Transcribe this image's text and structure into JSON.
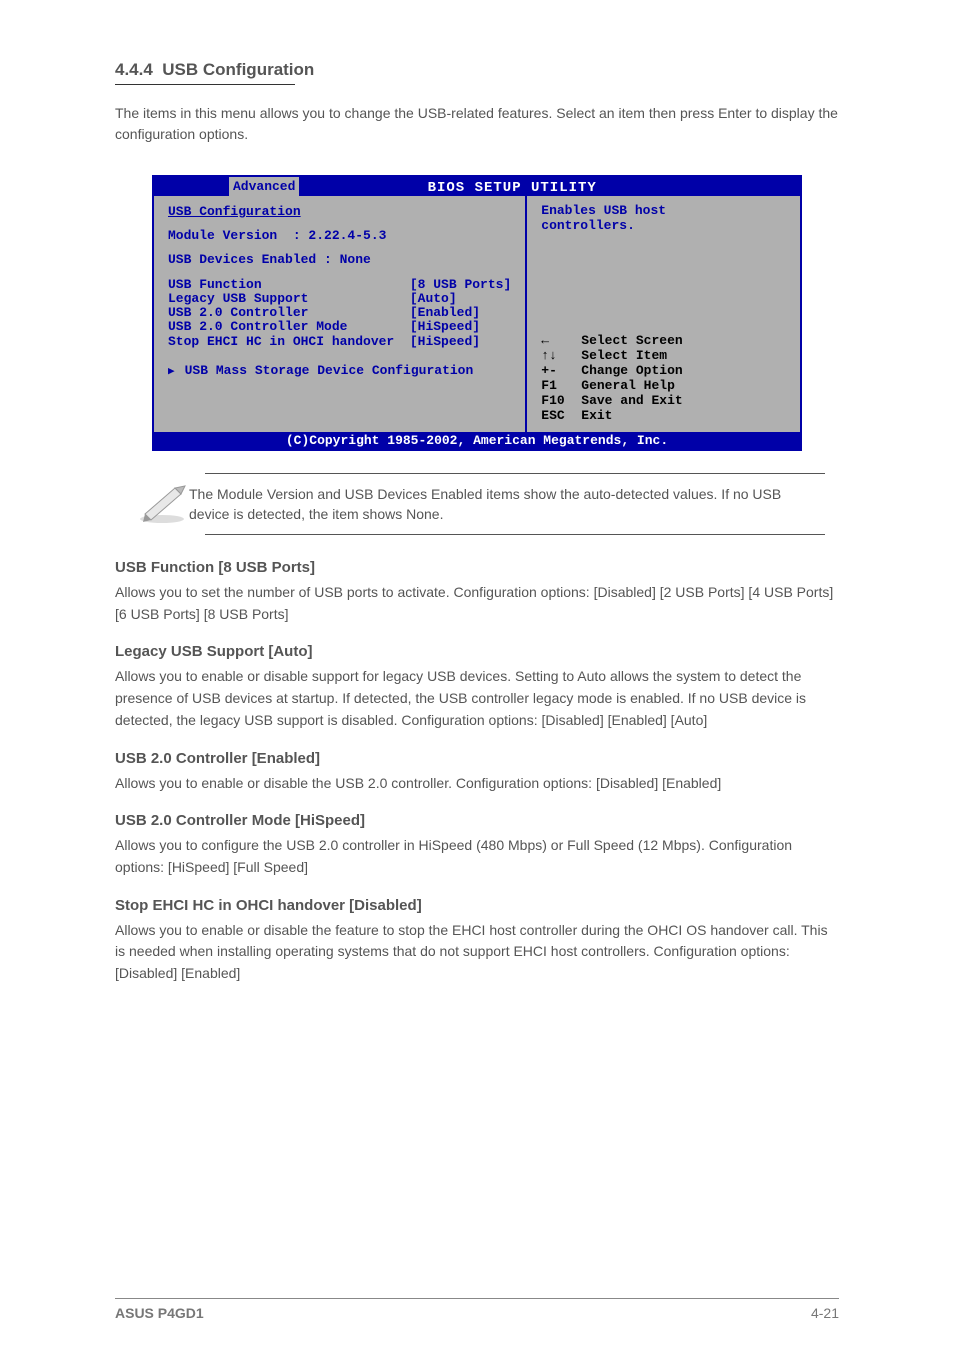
{
  "section": {
    "number": "4.4.4",
    "title": "USB Configuration",
    "description": "The items in this menu allows you to change the USB-related features. Select an item then press Enter to display the configuration options."
  },
  "bios": {
    "title": "BIOS SETUP UTILITY",
    "tab": "Advanced",
    "section_label": "USB Configuration",
    "module_version_label": "Module Version  : 2.22.4-5.3",
    "usb_devices_label": "USB Devices Enabled : None",
    "settings": [
      {
        "label": "USB Function",
        "value": "[8 USB Ports]"
      },
      {
        "label": "Legacy USB Support",
        "value": "[Auto]"
      },
      {
        "label": "USB 2.0 Controller",
        "value": "[Enabled]"
      },
      {
        "label": "USB 2.0 Controller Mode",
        "value": "[HiSpeed]"
      },
      {
        "label": "Stop EHCI HC in OHCI handover",
        "value": "[HiSpeed]"
      }
    ],
    "submenu": "USB Mass Storage Device Configuration",
    "hint": "Enables USB host\ncontrollers.",
    "nav": [
      {
        "key": "←",
        "text": "Select Screen"
      },
      {
        "key": "↑↓",
        "text": "Select Item"
      },
      {
        "key": "+-",
        "text": "Change Option"
      },
      {
        "key": "F1",
        "text": "General Help"
      },
      {
        "key": "F10",
        "text": "Save and Exit"
      },
      {
        "key": "ESC",
        "text": "Exit"
      }
    ],
    "copyright": "(C)Copyright 1985-2002, American Megatrends, Inc."
  },
  "note": "The Module Version and USB Devices Enabled items show the auto-detected values. If no USB device is detected, the item shows None.",
  "items": [
    {
      "title": "USB Function [8 USB Ports]",
      "desc": "Allows you to set the number of USB ports to activate. Configuration options: [Disabled] [2 USB Ports] [4 USB Ports] [6 USB Ports] [8 USB Ports]"
    },
    {
      "title": "Legacy USB Support [Auto]",
      "desc": "Allows you to enable or disable support for legacy USB devices. Setting to Auto allows the system to detect the presence of USB devices at startup. If detected, the USB controller legacy mode is enabled. If no USB device is detected, the legacy USB support is disabled. Configuration options: [Disabled] [Enabled] [Auto]"
    },
    {
      "title": "USB 2.0 Controller [Enabled]",
      "desc": "Allows you to enable or disable the USB 2.0 controller. Configuration options: [Disabled] [Enabled]"
    },
    {
      "title": "USB 2.0 Controller Mode [HiSpeed]",
      "desc": "Allows you to configure the USB 2.0 controller in HiSpeed (480 Mbps) or Full Speed (12 Mbps). Configuration options: [HiSpeed] [Full Speed]"
    },
    {
      "title": "Stop EHCI HC in OHCI handover [Disabled]",
      "desc": "Allows you to enable or disable the feature to stop the EHCI host controller during the OHCI OS handover call. This is needed when installing operating systems that do not support EHCI host controllers. Configuration options: [Disabled] [Enabled]"
    }
  ],
  "footer": {
    "left": "ASUS P4GD1",
    "right": "4-21"
  }
}
